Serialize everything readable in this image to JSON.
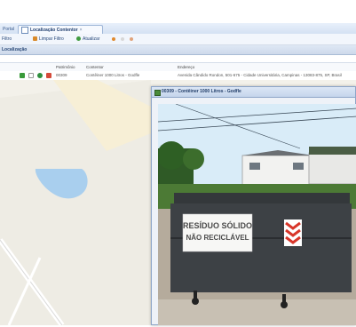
{
  "tabs": [
    {
      "label": "Portal",
      "active": false
    },
    {
      "label": "Localização Contentor",
      "active": true,
      "close": "×"
    }
  ],
  "toolbar": {
    "first_label": "Filtro",
    "clear_filter_label": "Limpar Filtro",
    "update_label": "Atualizar"
  },
  "section_title": "Localização",
  "grid": {
    "columns": [
      "Patrimônio",
      "Contentor",
      "Endereço"
    ],
    "rows": [
      {
        "patrimonio": "00309",
        "contentor": "Contêiner 1000 Litros - Godfle",
        "endereco": "Avenida Cândido Rondon, 501-675 - Cidade Universitária, Campinas - 13083-875, SP, Brasil"
      }
    ]
  },
  "popup": {
    "title": "00309 - Contêiner 1000 Litros - Godfle",
    "photo_sign_line1": "RESÍDUO SÓLIDO",
    "photo_sign_line2": "NÃO RECICLÁVEL"
  },
  "colors": {
    "accent": "#3a5a8c",
    "container_gray": "#3d4145",
    "lake": "#a9cfee",
    "grass": "#4c7a35",
    "sky": "#d9ecf8"
  }
}
